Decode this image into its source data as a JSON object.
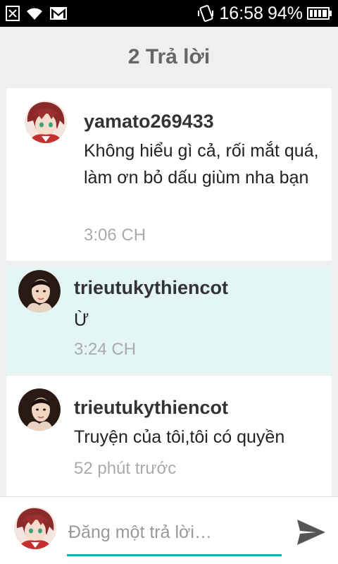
{
  "status_bar": {
    "time": "16:58",
    "battery_percent": "94%",
    "icons": [
      "notification-x-icon",
      "wifi-icon",
      "gmail-icon",
      "vibrate-icon",
      "battery-icon"
    ]
  },
  "header": {
    "title": "2 Trả lời"
  },
  "comments": [
    {
      "username": "yamato269433",
      "message": "Không hiểu gì cả, rối mắt quá, làm ơn bỏ dấu giùm nha bạn",
      "time": "3:06 CH",
      "avatar": "avatar-red-hair"
    },
    {
      "username": "trieutukythiencot",
      "message": "Ừ",
      "time": "3:24 CH",
      "avatar": "avatar-girl",
      "highlighted": true
    },
    {
      "username": "trieutukythiencot",
      "message": "Truyện của tôi,tôi có quyền",
      "time": "52 phút trước",
      "avatar": "avatar-girl"
    }
  ],
  "compose": {
    "placeholder": "Đăng một trả lời…",
    "send_icon": "send-icon"
  },
  "colors": {
    "accent": "#1aaea8",
    "highlight_bg": "#e3f5f5",
    "page_bg": "#efefef"
  }
}
